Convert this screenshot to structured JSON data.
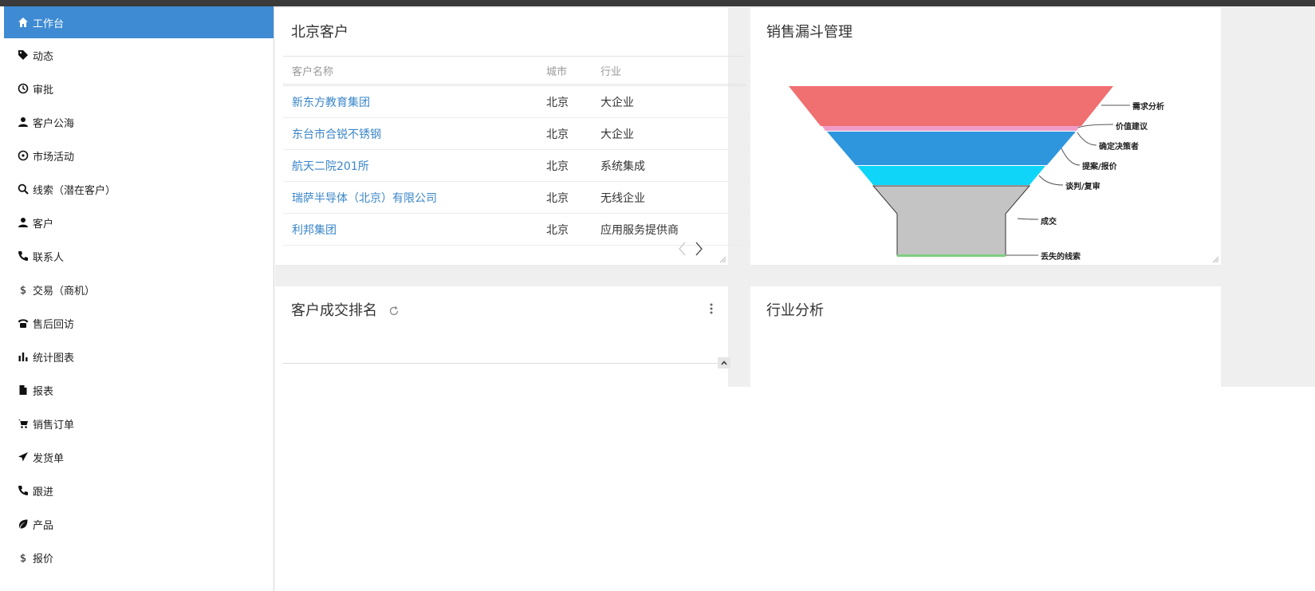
{
  "sidebar": {
    "items": [
      {
        "label": "工作台",
        "icon": "home-icon",
        "active": true
      },
      {
        "label": "动态",
        "icon": "tag-icon"
      },
      {
        "label": "审批",
        "icon": "clock-icon"
      },
      {
        "label": "客户公海",
        "icon": "user-icon"
      },
      {
        "label": "市场活动",
        "icon": "target-icon"
      },
      {
        "label": "线索（潜在客户）",
        "icon": "search-icon"
      },
      {
        "label": "客户",
        "icon": "user-icon"
      },
      {
        "label": "联系人",
        "icon": "phone-icon"
      },
      {
        "label": "交易（商机）",
        "icon": "dollar-icon"
      },
      {
        "label": "售后回访",
        "icon": "telephone-icon"
      },
      {
        "label": "统计图表",
        "icon": "bar-chart-icon"
      },
      {
        "label": "报表",
        "icon": "file-icon"
      },
      {
        "label": "销售订单",
        "icon": "cart-icon"
      },
      {
        "label": "发货单",
        "icon": "send-icon"
      },
      {
        "label": "跟进",
        "icon": "phone-icon"
      },
      {
        "label": "产品",
        "icon": "leaf-icon"
      },
      {
        "label": "报价",
        "icon": "dollar-icon"
      }
    ]
  },
  "customers_panel": {
    "title": "北京客户",
    "columns": [
      "客户名称",
      "城市",
      "行业"
    ],
    "rows": [
      {
        "name": "新东方教育集团",
        "city": "北京",
        "industry": "大企业"
      },
      {
        "name": "东台市合锐不锈钢",
        "city": "北京",
        "industry": "大企业"
      },
      {
        "name": "航天二院201所",
        "city": "北京",
        "industry": "系统集成"
      },
      {
        "name": "瑞萨半导体（北京）有限公司",
        "city": "北京",
        "industry": "无线企业"
      },
      {
        "name": "利邦集团",
        "city": "北京",
        "industry": "应用服务提供商"
      }
    ]
  },
  "funnel_panel": {
    "title": "销售漏斗管理",
    "stages": [
      {
        "label": "需求分析",
        "color": "#f06f70"
      },
      {
        "label": "价值建议",
        "color": "#f09cc8"
      },
      {
        "label": "确定决策者",
        "color": "#2e96dd"
      },
      {
        "label": "提案/报价",
        "color": "#0fd6f8"
      },
      {
        "label": "谈判/复审",
        "color": "#c4c4c4"
      },
      {
        "label": "成交",
        "color": "#c4c4c4"
      },
      {
        "label": "丢失的线索",
        "color": "#7ecf7e"
      }
    ]
  },
  "ranking_panel": {
    "title": "客户成交排名"
  },
  "industry_panel": {
    "title": "行业分析"
  }
}
